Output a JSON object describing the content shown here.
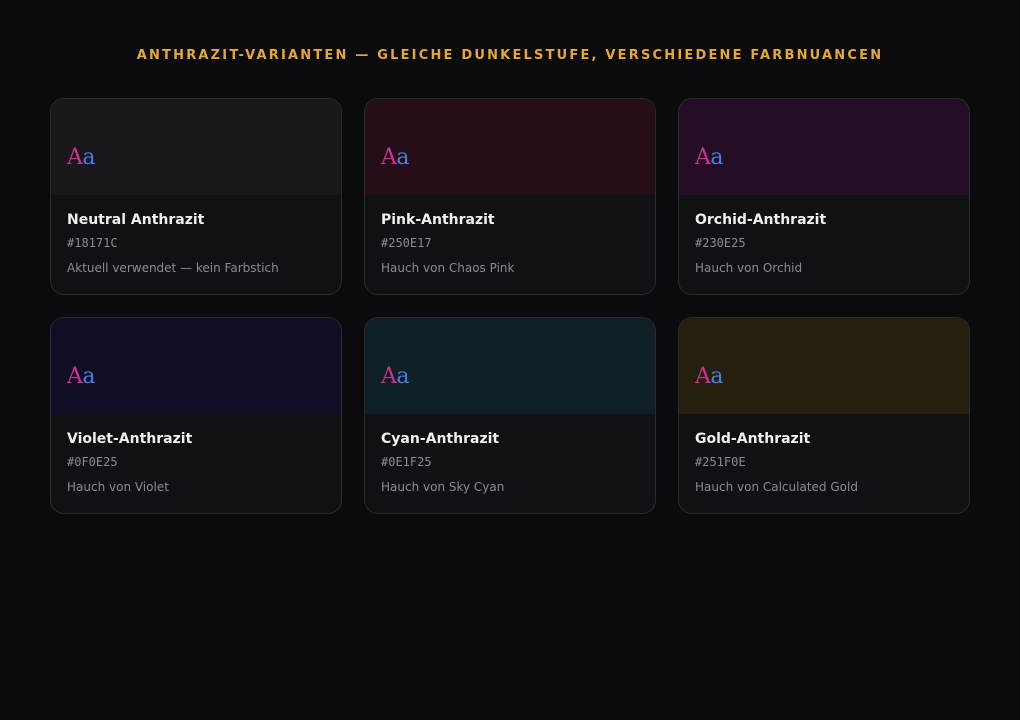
{
  "page": {
    "title": "ANTHRAZIT-VARIANTEN — GLEICHE DUNKELSTUFE, VERSCHIEDENE FARBNUANCEN",
    "accent_color": "#e5a836",
    "background_color": "#0b0b0d"
  },
  "sample": {
    "upper": "A",
    "lower": "a",
    "upper_color": "#cd2f93",
    "lower_color": "#4a7fe0"
  },
  "cards": [
    {
      "name": "Neutral Anthrazit",
      "hex": "#18171C",
      "desc": "Aktuell verwendet — kein Farbstich",
      "color": "#18171C"
    },
    {
      "name": "Pink-Anthrazit",
      "hex": "#250E17",
      "desc": "Hauch von Chaos Pink",
      "color": "#250E17"
    },
    {
      "name": "Orchid-Anthrazit",
      "hex": "#230E25",
      "desc": "Hauch von Orchid",
      "color": "#230E25"
    },
    {
      "name": "Violet-Anthrazit",
      "hex": "#0F0E25",
      "desc": "Hauch von Violet",
      "color": "#0F0E25"
    },
    {
      "name": "Cyan-Anthrazit",
      "hex": "#0E1F25",
      "desc": "Hauch von Sky Cyan",
      "color": "#0E1F25"
    },
    {
      "name": "Gold-Anthrazit",
      "hex": "#251F0E",
      "desc": "Hauch von Calculated Gold",
      "color": "#251F0E"
    }
  ]
}
